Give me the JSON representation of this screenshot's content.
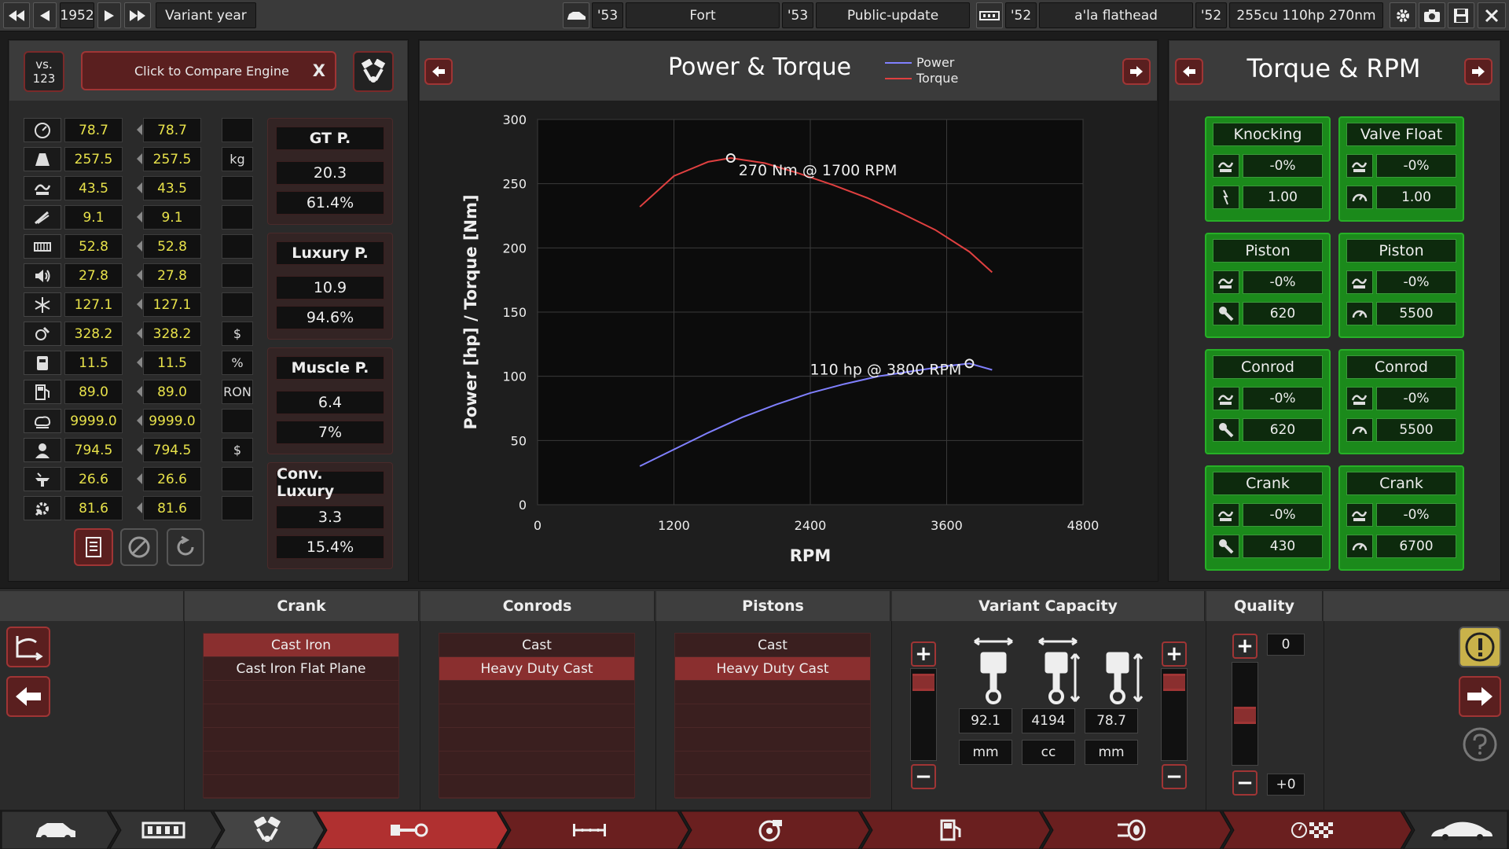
{
  "topbar": {
    "year": "1952",
    "variant_label": "Variant year",
    "car_year": "'53",
    "car_name": "Fort",
    "trim_year": "'53",
    "trim_name": "Public-update",
    "engine_year": "'52",
    "engine_name": "a'la flathead",
    "variant_year": "'52",
    "variant_name": "255cu 110hp 270nm"
  },
  "compare": {
    "vs_label": "vs.",
    "vs_number": "123",
    "button_label": "Click to Compare Engine",
    "close": "X"
  },
  "stats": [
    {
      "icon": "speedometer-icon",
      "a": "78.7",
      "b": "78.7",
      "unit": ""
    },
    {
      "icon": "weight-icon",
      "a": "257.5",
      "b": "257.5",
      "unit": "kg"
    },
    {
      "icon": "smoothness-icon",
      "a": "43.5",
      "b": "43.5",
      "unit": ""
    },
    {
      "icon": "throttle-icon",
      "a": "9.1",
      "b": "9.1",
      "unit": ""
    },
    {
      "icon": "engine-block-icon",
      "a": "52.8",
      "b": "52.8",
      "unit": ""
    },
    {
      "icon": "noise-icon",
      "a": "27.8",
      "b": "27.8",
      "unit": ""
    },
    {
      "icon": "cooling-icon",
      "a": "127.1",
      "b": "127.1",
      "unit": ""
    },
    {
      "icon": "cost-icon",
      "a": "328.2",
      "b": "328.2",
      "unit": "$"
    },
    {
      "icon": "efficiency-icon",
      "a": "11.5",
      "b": "11.5",
      "unit": "%"
    },
    {
      "icon": "fuel-pump-icon",
      "a": "89.0",
      "b": "89.0",
      "unit": "RON"
    },
    {
      "icon": "emissions-icon",
      "a": "9999.0",
      "b": "9999.0",
      "unit": ""
    },
    {
      "icon": "engineer-cost-icon",
      "a": "794.5",
      "b": "794.5",
      "unit": "$"
    },
    {
      "icon": "production-icon",
      "a": "26.6",
      "b": "26.6",
      "unit": ""
    },
    {
      "icon": "service-cost-icon",
      "a": "81.6",
      "b": "81.6",
      "unit": ""
    }
  ],
  "groups": [
    {
      "title": "GT P.",
      "v1": "20.3",
      "v2": "61.4%"
    },
    {
      "title": "Luxury P.",
      "v1": "10.9",
      "v2": "94.6%"
    },
    {
      "title": "Muscle P.",
      "v1": "6.4",
      "v2": "7%"
    },
    {
      "title": "Conv. Luxury",
      "v1": "3.3",
      "v2": "15.4%"
    }
  ],
  "power_torque": {
    "title": "Power & Torque",
    "legend_power": "Power",
    "legend_torque": "Torque"
  },
  "torque_rpm": {
    "title": "Torque & RPM",
    "cards": [
      {
        "title": "Knocking",
        "pct": "-0%",
        "val": "1.00",
        "icon2": "spark-icon"
      },
      {
        "title": "Valve Float",
        "pct": "-0%",
        "val": "1.00",
        "icon2": "rpm-gauge-icon"
      },
      {
        "title": "Piston",
        "pct": "-0%",
        "val": "620",
        "icon2": "wrench-icon"
      },
      {
        "title": "Piston",
        "pct": "-0%",
        "val": "5500",
        "icon2": "rpm-gauge-icon"
      },
      {
        "title": "Conrod",
        "pct": "-0%",
        "val": "620",
        "icon2": "wrench-icon"
      },
      {
        "title": "Conrod",
        "pct": "-0%",
        "val": "5500",
        "icon2": "rpm-gauge-icon"
      },
      {
        "title": "Crank",
        "pct": "-0%",
        "val": "430",
        "icon2": "wrench-icon"
      },
      {
        "title": "Crank",
        "pct": "-0%",
        "val": "6700",
        "icon2": "rpm-gauge-icon"
      }
    ]
  },
  "sections": {
    "crank": {
      "title": "Crank",
      "items": [
        "Cast Iron",
        "Cast Iron Flat Plane"
      ],
      "selected": 0
    },
    "conrods": {
      "title": "Conrods",
      "items": [
        "Cast",
        "Heavy Duty Cast"
      ],
      "selected": 1
    },
    "pistons": {
      "title": "Pistons",
      "items": [
        "Cast",
        "Heavy Duty Cast"
      ],
      "selected": 1
    },
    "capacity": {
      "title": "Variant Capacity",
      "bore": "92.1",
      "disp": "4194",
      "stroke": "78.7",
      "bore_unit": "mm",
      "disp_unit": "cc",
      "stroke_unit": "mm"
    },
    "quality": {
      "title": "Quality",
      "top": "0",
      "bottom": "+0"
    }
  },
  "chart_data": {
    "type": "line",
    "title": "Power & Torque",
    "xlabel": "RPM",
    "ylabel": "Power [hp] / Torque [Nm]",
    "xlim": [
      0,
      4800
    ],
    "ylim": [
      0,
      300
    ],
    "xticks": [
      0,
      1200,
      2400,
      3600,
      4800
    ],
    "yticks": [
      0,
      50,
      100,
      150,
      200,
      250,
      300
    ],
    "grid": true,
    "legend": "top",
    "series": [
      {
        "name": "Power",
        "color": "#8080ff",
        "x": [
          900,
          1200,
          1500,
          1800,
          2100,
          2400,
          2700,
          3000,
          3300,
          3600,
          3800,
          4000
        ],
        "y": [
          30,
          43,
          56,
          68,
          78,
          87,
          94,
          100,
          104,
          108,
          110,
          105
        ]
      },
      {
        "name": "Torque",
        "color": "#e04040",
        "x": [
          900,
          1200,
          1500,
          1700,
          2000,
          2300,
          2600,
          2900,
          3200,
          3500,
          3800,
          4000
        ],
        "y": [
          232,
          256,
          267,
          270,
          266,
          258,
          249,
          239,
          227,
          214,
          197,
          181
        ]
      }
    ],
    "annotations": [
      {
        "text": "270 Nm @ 1700 RPM",
        "x": 1700,
        "y": 270
      },
      {
        "text": "110 hp @ 3800 RPM",
        "x": 3800,
        "y": 110
      }
    ]
  }
}
